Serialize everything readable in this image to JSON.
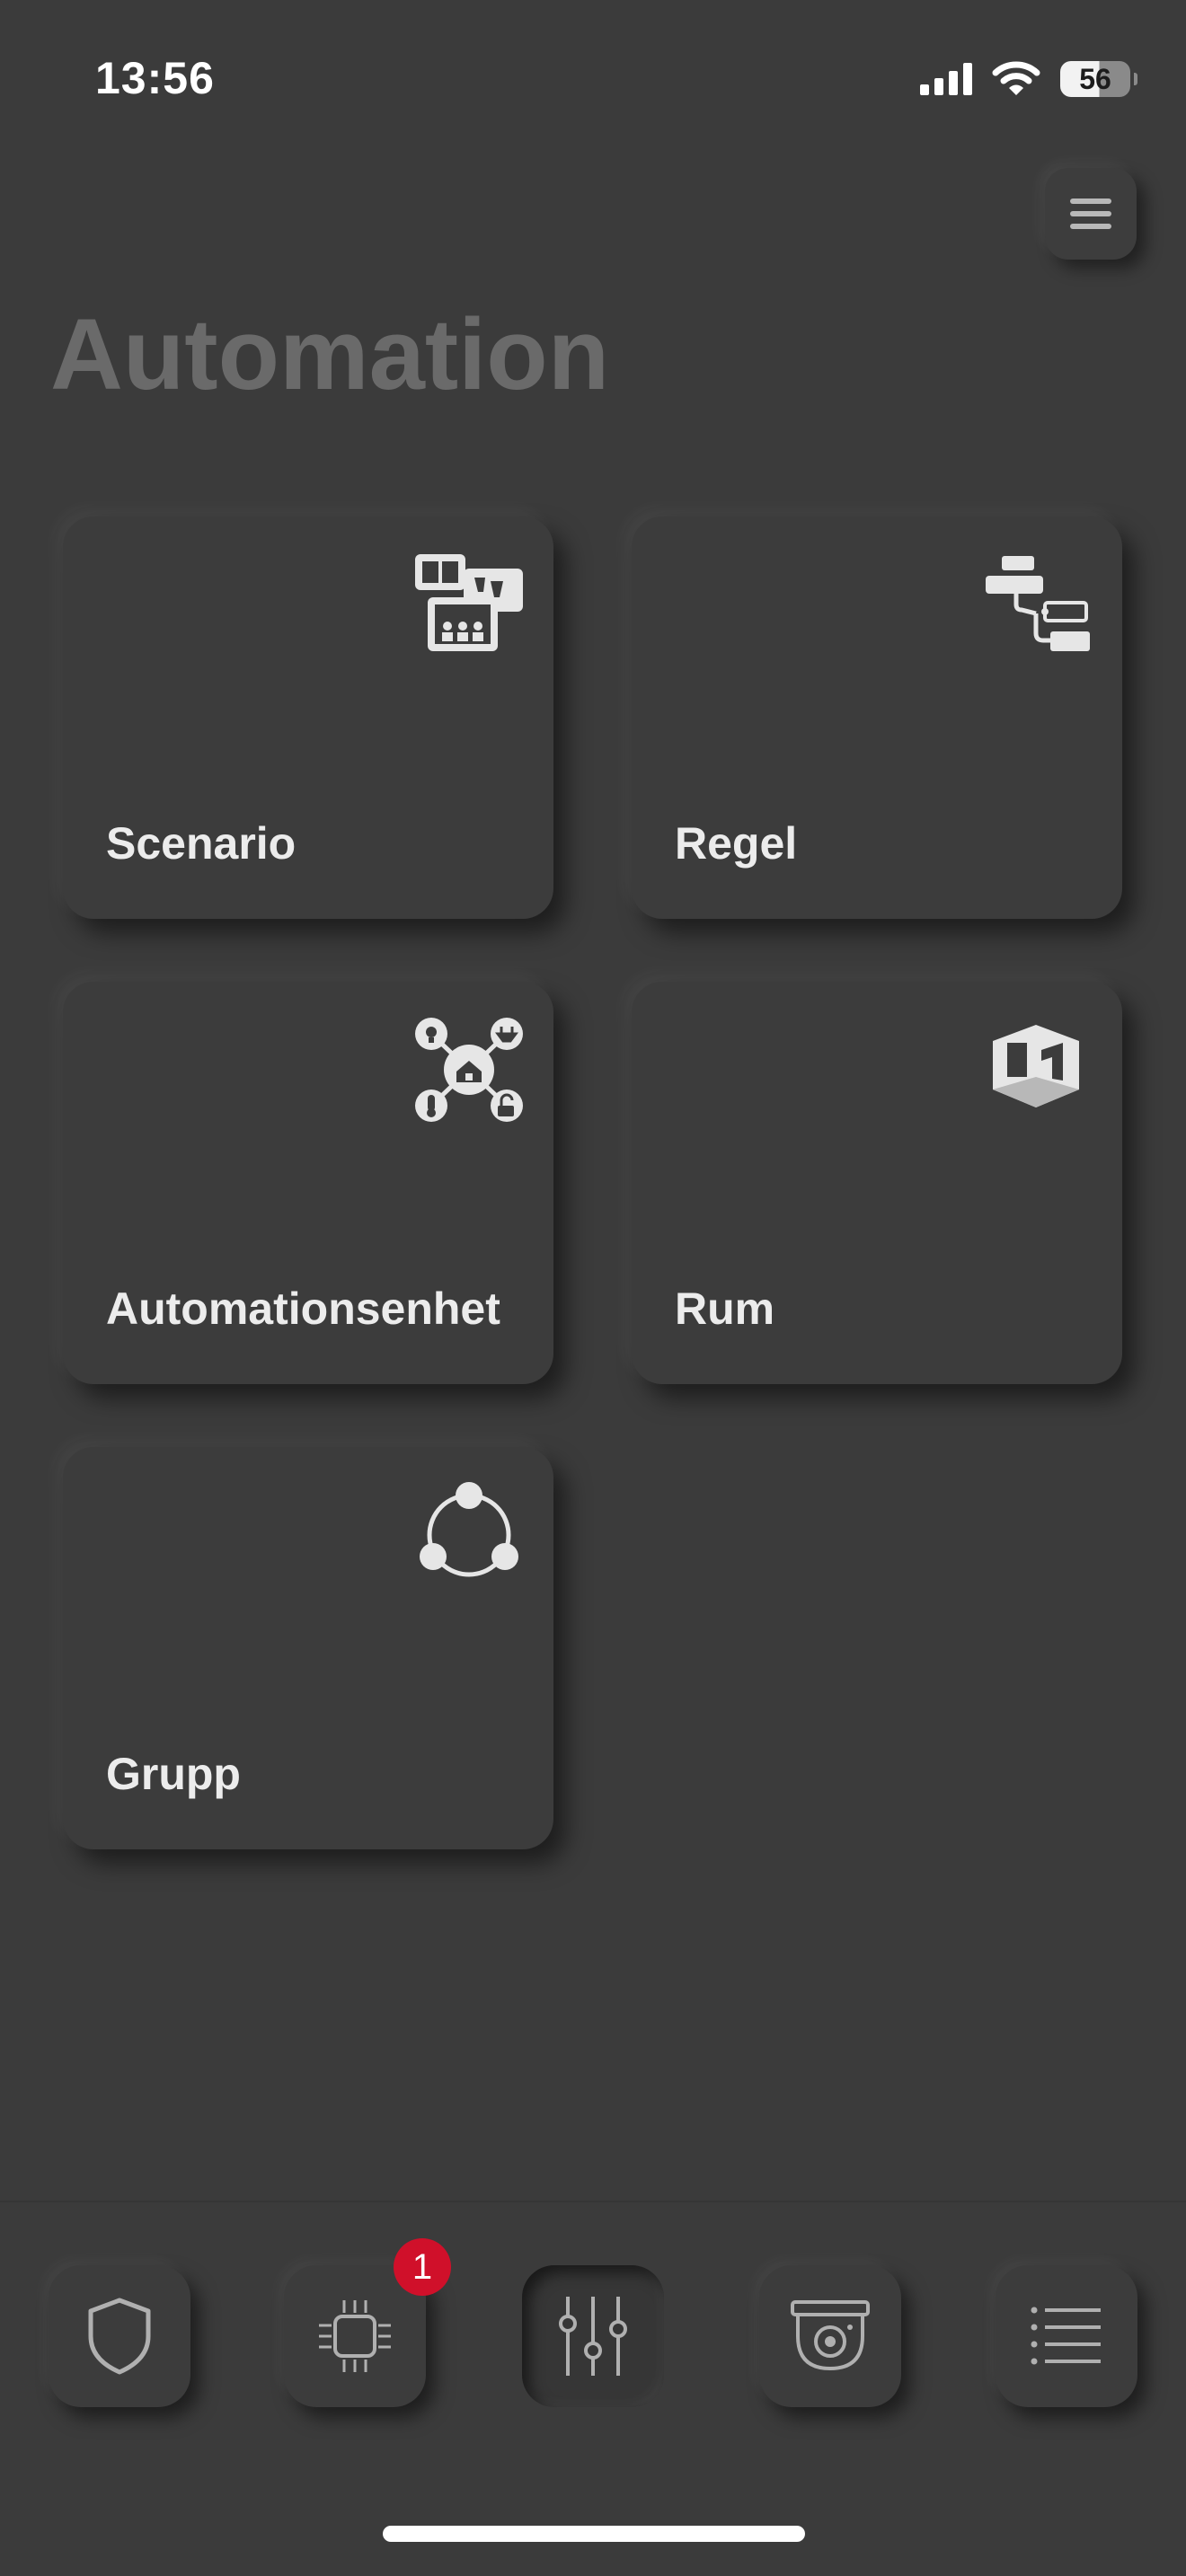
{
  "status_bar": {
    "time": "13:56",
    "battery": "56"
  },
  "header": {
    "title": "Automation",
    "menu_icon": "hamburger-menu-icon"
  },
  "cards": [
    {
      "label": "Scenario",
      "icon": "scenario-pictures-icon"
    },
    {
      "label": "Regel",
      "icon": "rule-flow-icon"
    },
    {
      "label": "Automationsenhet",
      "icon": "automation-device-hub-icon"
    },
    {
      "label": "Rum",
      "icon": "room-cube-icon"
    },
    {
      "label": "Grupp",
      "icon": "group-circle-icon"
    }
  ],
  "bottom_nav": {
    "items": [
      {
        "icon": "shield-icon",
        "active": false
      },
      {
        "icon": "chip-icon",
        "active": false,
        "badge": "1"
      },
      {
        "icon": "sliders-icon",
        "active": true
      },
      {
        "icon": "camera-icon",
        "active": false
      },
      {
        "icon": "list-icon",
        "active": false
      }
    ]
  },
  "colors": {
    "background": "#3b3b3b",
    "title": "#6a6a6a",
    "card_text": "#ececec",
    "badge": "#d0102a"
  }
}
